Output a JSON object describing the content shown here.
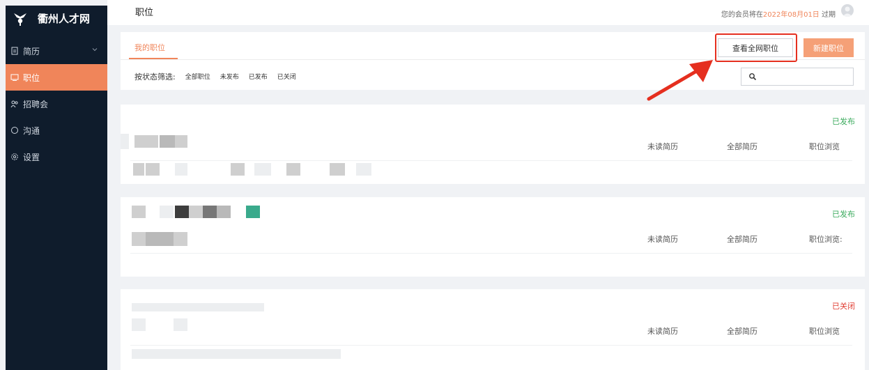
{
  "brand": {
    "name": "衢州人才网"
  },
  "sidebar": {
    "items": [
      {
        "label": "简历",
        "icon": "document-icon",
        "active": false,
        "expandable": true
      },
      {
        "label": "职位",
        "icon": "monitor-icon",
        "active": true,
        "expandable": false
      },
      {
        "label": "招聘会",
        "icon": "people-icon",
        "active": false,
        "expandable": false
      },
      {
        "label": "沟通",
        "icon": "chat-icon",
        "active": false,
        "expandable": false
      },
      {
        "label": "设置",
        "icon": "gear-icon",
        "active": false,
        "expandable": false
      }
    ]
  },
  "header": {
    "title": "职位",
    "member_prefix": "您的会员将在",
    "member_date": "2022年08月01日",
    "member_suffix": " 过期"
  },
  "toolbar": {
    "tab_label": "我的职位",
    "view_all_label": "查看全网职位",
    "new_job_label": "新建职位",
    "filter_label": "按状态筛选:",
    "filter_options": [
      "全部职位",
      "未发布",
      "已发布",
      "已关闭"
    ],
    "search_placeholder": ""
  },
  "jobs": [
    {
      "status": "已发布",
      "unread_label": "未读简历",
      "all_label": "全部简历",
      "views_label": "职位浏览"
    },
    {
      "status": "已发布",
      "unread_label": "未读简历",
      "all_label": "全部简历",
      "views_label": "职位浏览:"
    },
    {
      "status": "已关闭",
      "unread_label": "未读简历",
      "all_label": "全部简历",
      "views_label": "职位浏览"
    }
  ],
  "colors": {
    "accent": "#f0855a",
    "published": "#3aaa5c",
    "closed": "#e03c31",
    "highlight": "#e52f1f",
    "sidebar_bg": "#0f1c2c"
  }
}
